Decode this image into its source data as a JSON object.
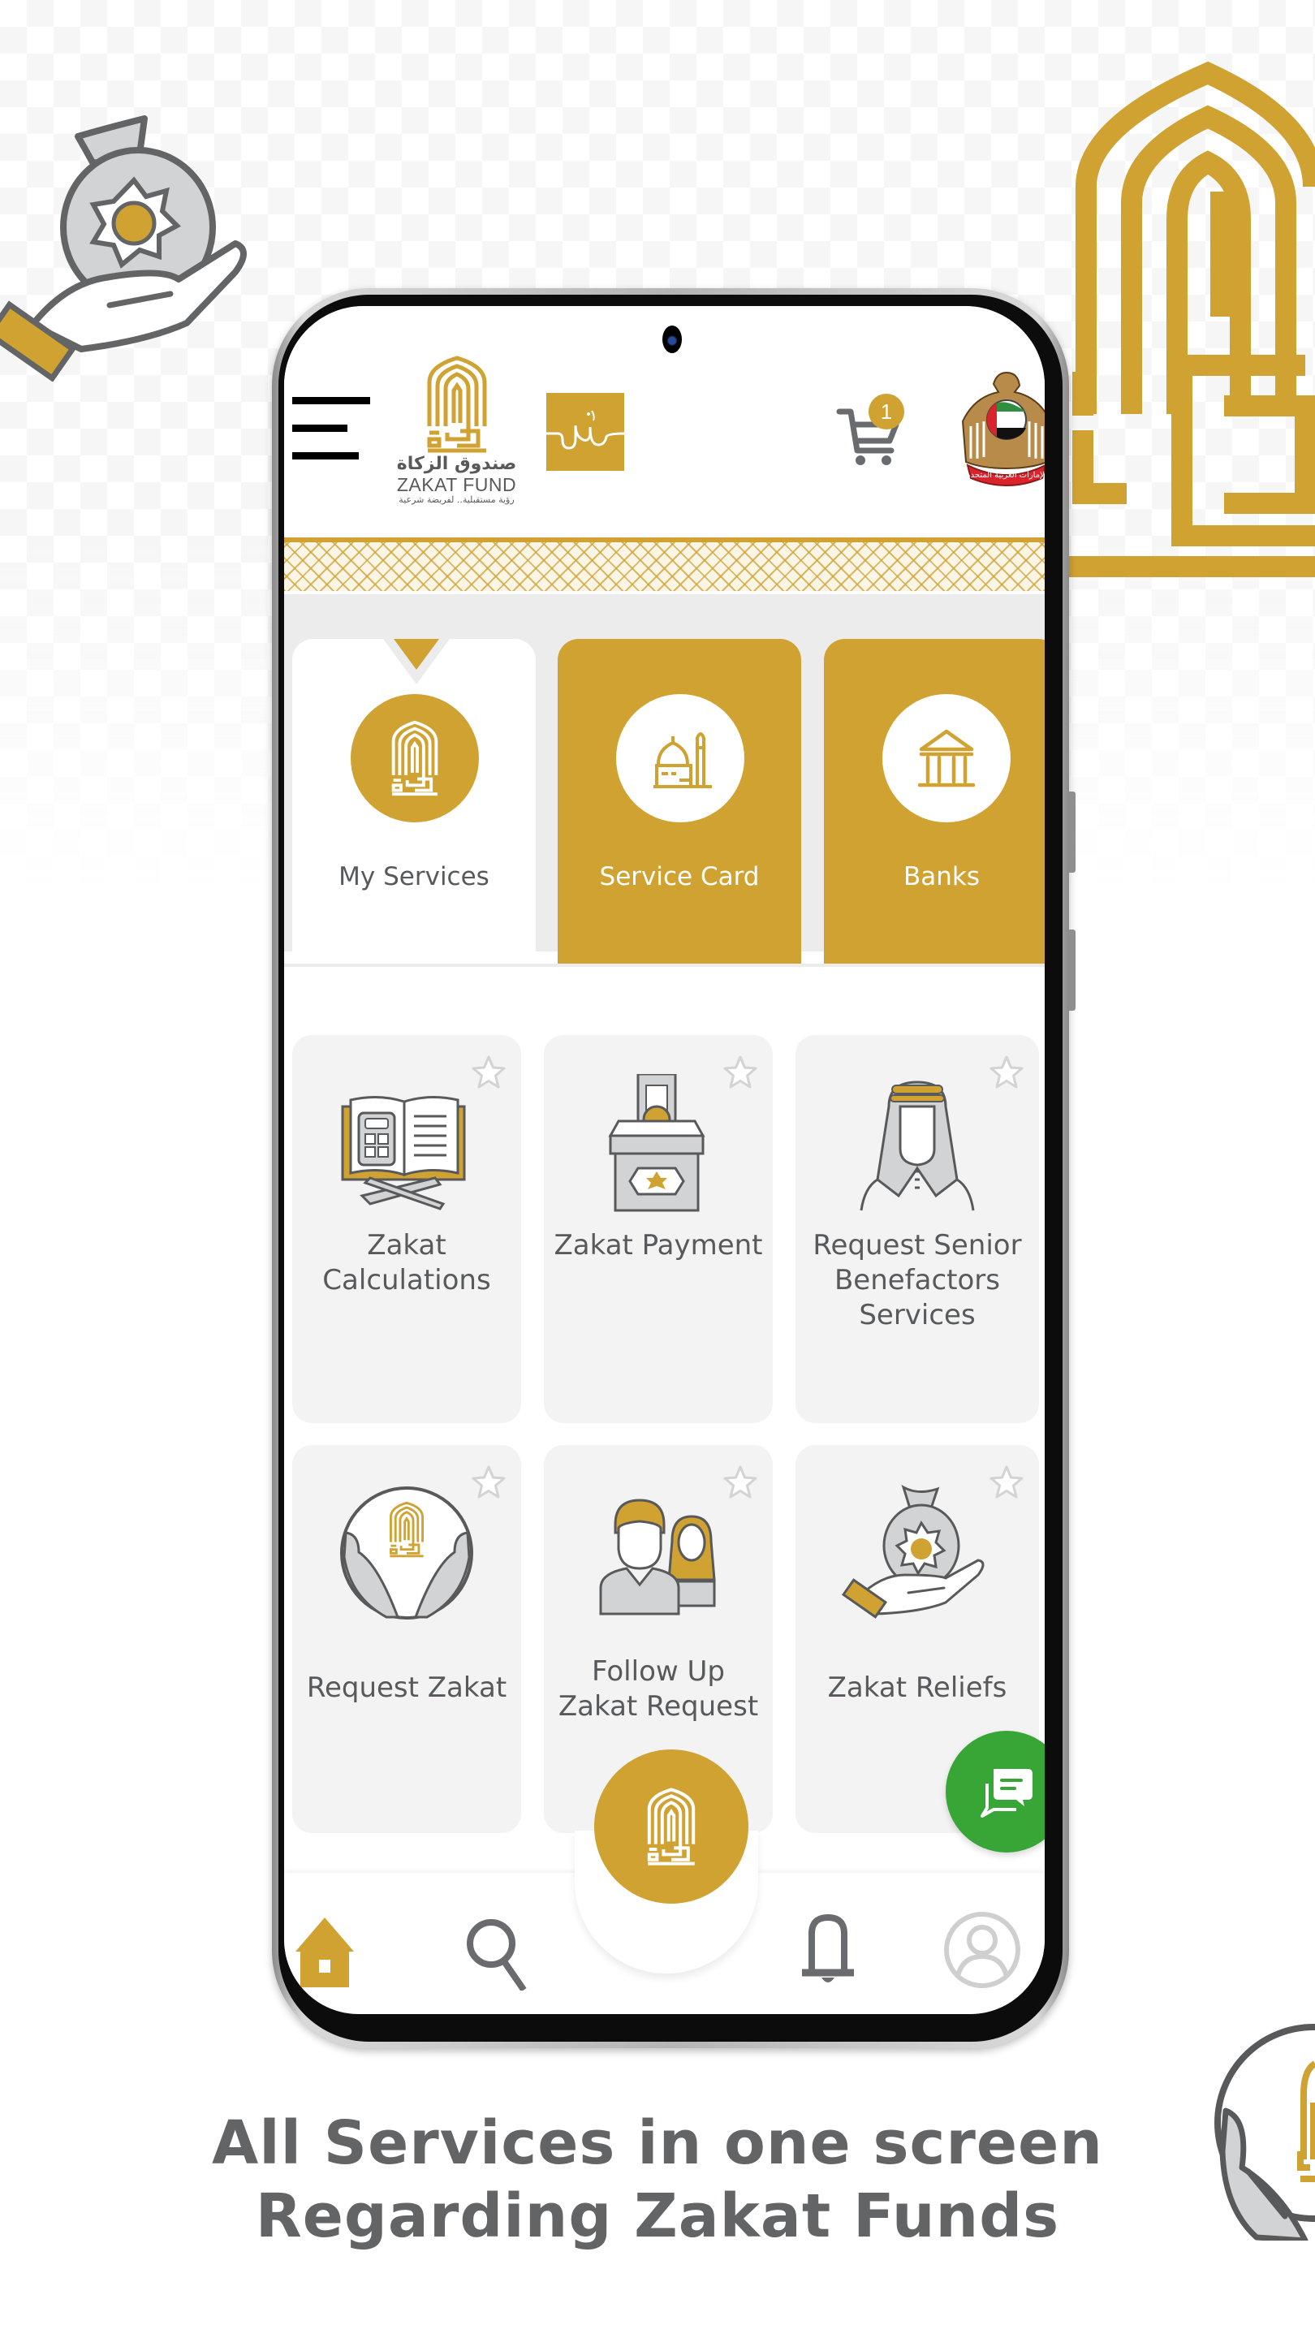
{
  "app": {
    "brand_name_ar": "صندوق الزكاة",
    "brand_name_en": "ZAKAT FUND",
    "brand_tagline_ar": "رؤية مستقبلية.. لفريضة شرعية",
    "emblem_banner_ar": "الإمارات العربية المتحدة"
  },
  "header": {
    "menu_icon": "hamburger-menu-icon",
    "cart_icon": "shopping-cart-icon",
    "cart_count": "1"
  },
  "tabs": [
    {
      "label": "My Services",
      "icon": "zakat-logo-icon",
      "active": true
    },
    {
      "label": "Service Card",
      "icon": "mosque-icon",
      "active": false
    },
    {
      "label": "Banks",
      "icon": "bank-icon",
      "active": false
    }
  ],
  "services": [
    {
      "label": "Zakat Calculations",
      "icon": "book-calculator-icon",
      "favorite": false
    },
    {
      "label": "Zakat Payment",
      "icon": "donation-box-icon",
      "favorite": false
    },
    {
      "label": "Request Senior Benefactors Services",
      "icon": "senior-man-icon",
      "favorite": false
    },
    {
      "label": "Request Zakat",
      "icon": "hands-zakat-icon",
      "favorite": false
    },
    {
      "label": "Follow Up Zakat Request",
      "icon": "people-icon",
      "favorite": false
    },
    {
      "label": "Zakat Reliefs",
      "icon": "money-bag-hand-icon",
      "favorite": false
    }
  ],
  "bottom_nav": [
    {
      "name": "home",
      "icon": "home-icon",
      "active": true
    },
    {
      "name": "search",
      "icon": "search-icon",
      "active": false
    },
    {
      "name": "zakat",
      "icon": "zakat-logo-icon",
      "active": false
    },
    {
      "name": "notifications",
      "icon": "bell-icon",
      "active": false
    },
    {
      "name": "profile",
      "icon": "user-avatar-icon",
      "active": false
    }
  ],
  "chat_button": {
    "icon": "chat-icon"
  },
  "colors": {
    "brand_gold": "#cfa232",
    "text_grey": "#58595b",
    "card_bg": "#f3f3f3",
    "chat_green": "#37a637"
  },
  "caption": {
    "line1": "All Services in one screen",
    "line2": "Regarding Zakat Funds"
  }
}
